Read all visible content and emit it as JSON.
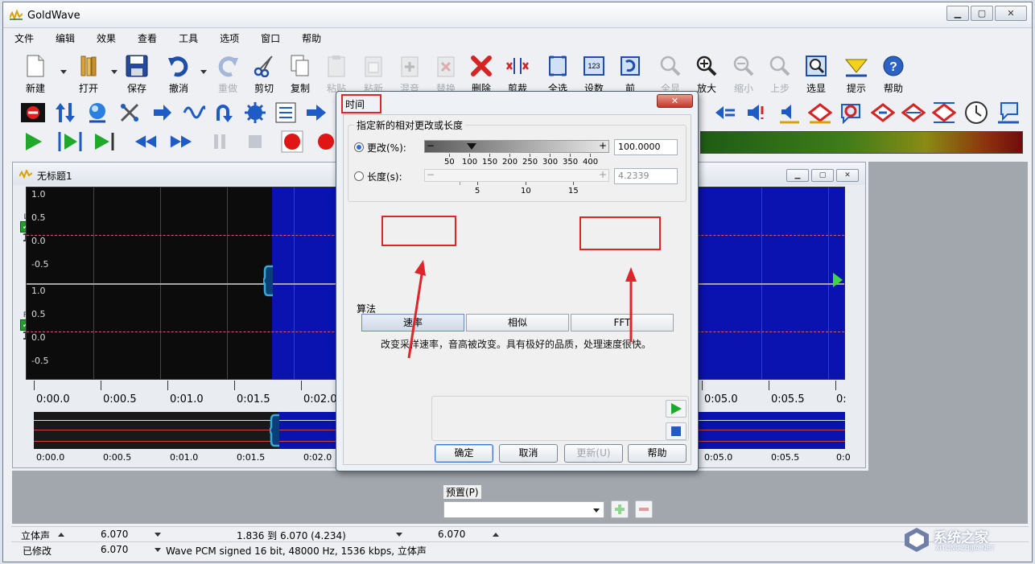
{
  "window": {
    "title": "GoldWave"
  },
  "menu": [
    "文件",
    "编辑",
    "效果",
    "查看",
    "工具",
    "选项",
    "窗口",
    "帮助"
  ],
  "toolbar": [
    {
      "label": "新建",
      "icon": "new-file-icon"
    },
    {
      "label": "打开",
      "icon": "open-folder-icon"
    },
    {
      "label": "保存",
      "icon": "save-disk-icon"
    },
    {
      "label": "撤消",
      "icon": "undo-icon"
    },
    {
      "label": "重做",
      "icon": "redo-icon"
    },
    {
      "label": "剪切",
      "icon": "scissors-icon"
    },
    {
      "label": "复制",
      "icon": "copy-icon"
    },
    {
      "label": "粘贴",
      "icon": "paste-icon"
    },
    {
      "label": "粘新",
      "icon": "paste-new-icon"
    },
    {
      "label": "混音",
      "icon": "mix-icon"
    },
    {
      "label": "替换",
      "icon": "replace-icon"
    },
    {
      "label": "删除",
      "icon": "delete-icon"
    },
    {
      "label": "剪裁",
      "icon": "trim-icon"
    },
    {
      "label": "全选",
      "icon": "select-all-icon"
    },
    {
      "label": "设数",
      "icon": "set-value-icon"
    },
    {
      "label": "前",
      "icon": "previous-icon"
    },
    {
      "label": "全显",
      "icon": "zoom-all-icon"
    },
    {
      "label": "放大",
      "icon": "zoom-in-icon"
    },
    {
      "label": "缩小",
      "icon": "zoom-out-icon"
    },
    {
      "label": "上步",
      "icon": "zoom-previous-icon"
    },
    {
      "label": "选显",
      "icon": "zoom-selection-icon"
    },
    {
      "label": "提示",
      "icon": "cue-icon"
    },
    {
      "label": "帮助",
      "icon": "help-icon"
    }
  ],
  "toolbar_set_value_badge": "123",
  "document": {
    "title": "无标题1",
    "channel_left": "L",
    "channel_right": "R",
    "channel_number": "1",
    "y_labels": [
      "1.0",
      "0.5",
      "0.0",
      "-0.5"
    ],
    "time_labels": [
      "0:00.0",
      "0:00.5",
      "0:01.0",
      "0:01.5",
      "0:02.0",
      "0:05.0",
      "0:05.5",
      "0:"
    ],
    "overview_labels": [
      "0:00.0",
      "0:00.5",
      "0:01.0",
      "0:01.5",
      "0:02.0",
      "0:05.0",
      "0:05.5",
      "0:0"
    ]
  },
  "status": {
    "row1": {
      "channel": "立体声",
      "value": "6.070",
      "range": "1.836 到 6.070 (4.234)",
      "value2": "6.070"
    },
    "row2": {
      "state": "已修改",
      "value": "6.070",
      "format": "Wave PCM signed 16 bit, 48000 Hz, 1536 kbps, 立体声"
    }
  },
  "dialog": {
    "title": "时间",
    "group_label": "指定新的相对更改或长度",
    "change_label": "更改(%):",
    "change_value": "100.0000",
    "change_scale": [
      "50",
      "100",
      "150",
      "200",
      "250",
      "300",
      "350",
      "400"
    ],
    "length_label": "长度(s):",
    "length_value": "4.2339",
    "length_scale": [
      "5",
      "10",
      "15"
    ],
    "algorithm_label": "算法",
    "algorithms": [
      "速率",
      "相似",
      "FFT"
    ],
    "description": "改变采样速率，音高被改变。具有极好的品质，处理速度很快。",
    "preset_label": "预置(P)",
    "preset_value": "",
    "buttons": {
      "ok": "确定",
      "cancel": "取消",
      "update": "更新(U)",
      "help": "帮助"
    }
  },
  "watermark": {
    "text": "系统之家",
    "url": "XITONGZHIJIA.NET"
  },
  "colors": {
    "accent_red": "#e0252a",
    "selection_blue": "#0a12b0",
    "play_green": "#1fa82a"
  }
}
